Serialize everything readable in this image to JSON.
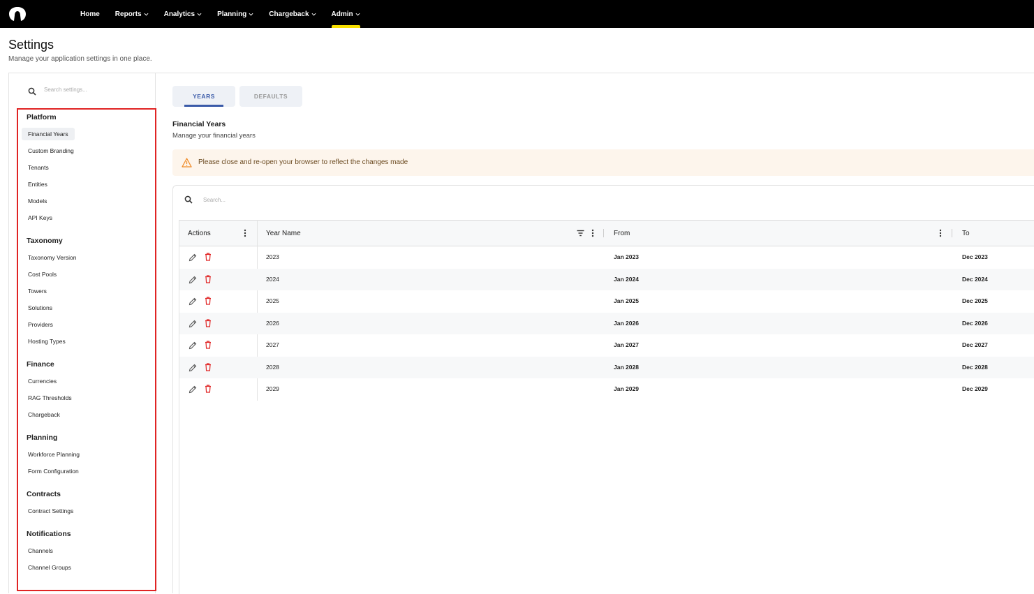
{
  "nav": {
    "items": [
      {
        "label": "Home",
        "has_menu": false
      },
      {
        "label": "Reports",
        "has_menu": true
      },
      {
        "label": "Analytics",
        "has_menu": true
      },
      {
        "label": "Planning",
        "has_menu": true
      },
      {
        "label": "Chargeback",
        "has_menu": true
      },
      {
        "label": "Admin",
        "has_menu": true,
        "active": true
      }
    ],
    "active_color": "#f8e000"
  },
  "page": {
    "title": "Settings",
    "subtitle": "Manage your application settings in one place."
  },
  "sidebar": {
    "search_placeholder": "Search settings...",
    "groups": [
      {
        "title": "Platform",
        "items": [
          "Financial Years",
          "Custom Branding",
          "Tenants",
          "Entities",
          "Models",
          "API Keys"
        ]
      },
      {
        "title": "Taxonomy",
        "items": [
          "Taxonomy Version",
          "Cost Pools",
          "Towers",
          "Solutions",
          "Providers",
          "Hosting Types"
        ]
      },
      {
        "title": "Finance",
        "items": [
          "Currencies",
          "RAG Thresholds",
          "Chargeback"
        ]
      },
      {
        "title": "Planning",
        "items": [
          "Workforce Planning",
          "Form Configuration"
        ]
      },
      {
        "title": "Contracts",
        "items": [
          "Contract Settings"
        ]
      },
      {
        "title": "Notifications",
        "items": [
          "Channels",
          "Channel Groups"
        ]
      }
    ],
    "active_item": "Financial Years",
    "highlight_color": "#e02424"
  },
  "tabs": [
    {
      "label": "YEARS",
      "active": true
    },
    {
      "label": "DEFAULTS",
      "active": false
    }
  ],
  "section": {
    "title": "Financial Years",
    "subtitle": "Manage your financial years"
  },
  "alert": {
    "text": "Please close and re-open your browser to reflect the changes made",
    "icon": "warning-icon",
    "color": "#f08c2a"
  },
  "grid": {
    "search_placeholder": "Search...",
    "columns": [
      "Actions",
      "Year Name",
      "From",
      "To"
    ],
    "rows": [
      {
        "year": "2023",
        "from": "Jan 2023",
        "to": "Dec 2023"
      },
      {
        "year": "2024",
        "from": "Jan 2024",
        "to": "Dec 2024"
      },
      {
        "year": "2025",
        "from": "Jan 2025",
        "to": "Dec 2025"
      },
      {
        "year": "2026",
        "from": "Jan 2026",
        "to": "Dec 2026"
      },
      {
        "year": "2027",
        "from": "Jan 2027",
        "to": "Dec 2027"
      },
      {
        "year": "2028",
        "from": "Jan 2028",
        "to": "Dec 2028"
      },
      {
        "year": "2029",
        "from": "Jan 2029",
        "to": "Dec 2029"
      }
    ],
    "delete_color": "#e02424"
  }
}
